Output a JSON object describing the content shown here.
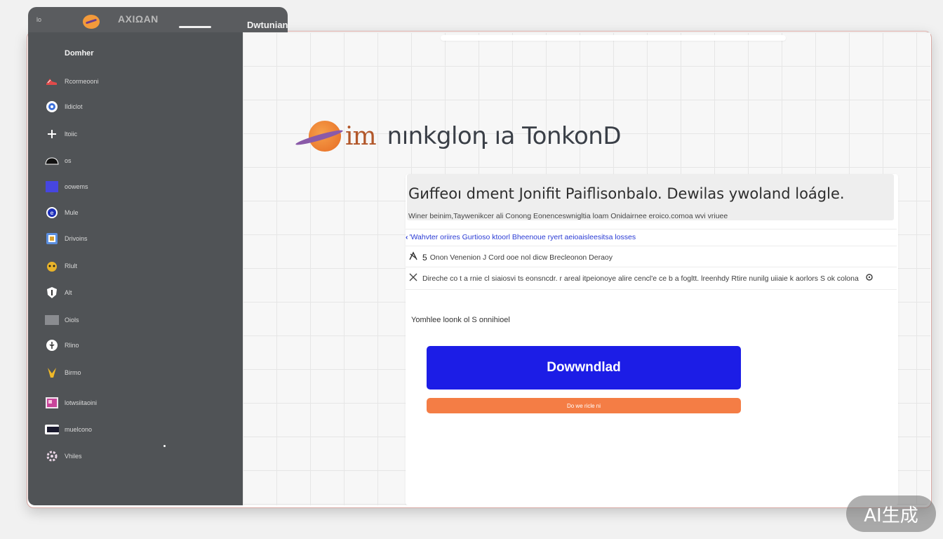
{
  "tab_bar": {
    "small_label": "lo",
    "title": "ΑΧΙΩΑΝ",
    "active_title": "Dwtunian"
  },
  "sidebar": {
    "header": "Domher",
    "items": [
      {
        "label": "Rcormeooni",
        "icon": "shoe-icon"
      },
      {
        "label": "Ildiclot",
        "icon": "eye-icon"
      },
      {
        "label": "ltoiic",
        "icon": "plus-icon"
      },
      {
        "label": "os",
        "icon": "cloud-icon"
      },
      {
        "label": "oowems",
        "icon": "square-icon"
      },
      {
        "label": "Mule",
        "icon": "circle-e-icon"
      },
      {
        "label": "Drivoins",
        "icon": "badge-icon"
      },
      {
        "label": "Rlult",
        "icon": "cat-icon"
      },
      {
        "label": "Alt",
        "icon": "shield-icon"
      },
      {
        "label": "Oiols",
        "icon": "rectangle-icon"
      },
      {
        "label": "Rlino",
        "icon": "pin-icon"
      },
      {
        "label": "Birmo",
        "icon": "bird-icon"
      },
      {
        "label": "lotwsiitaoini",
        "icon": "image-icon"
      },
      {
        "label": "muelcono",
        "icon": "monitor-icon"
      },
      {
        "label": "Vhiles",
        "icon": "gear-icon"
      }
    ]
  },
  "brand": {
    "prefix": "im",
    "name": "nınkgloդ ıa TonkonD"
  },
  "content": {
    "heading": "Gиffeoı dment Jonifit Paiflisonbalo. Dewilas ywoland loágle.",
    "subtext": "Winer beinim,Taywenikcer ali Conong Eonenceswnigltia loam Onidairnee eroico.comoa wvi vriuee",
    "link_text": "'Wahvter oriires Gurtioso ktoorl Bheenoue ryert aeioaisleesitsa losses",
    "row1": {
      "icon": "compass-icon",
      "num": "5",
      "text": "Onon Venenion J Cord ooe nol dicw Brecleonon Deraoy"
    },
    "row2": {
      "icon": "close-icon",
      "text": "Direche co t a rnie cl siaiosvi ts eonsncdr. r areal itpeionoye alire cencl'e ce b a fogltt. lreenhdy Rtire nunilg uiiaie k aorlors S ok colona",
      "end_icon": "info-icon"
    },
    "size_text": "Yomhlee loonk ol S onnihioel",
    "download_label": "Dowwndlad",
    "secondary_label": "Do we ricle ni"
  },
  "watermark": "AI生成",
  "colors": {
    "sidebar_bg": "#505356",
    "primary_button": "#1c1de6",
    "secondary_button": "#f47d45",
    "link": "#2a3bd4"
  }
}
